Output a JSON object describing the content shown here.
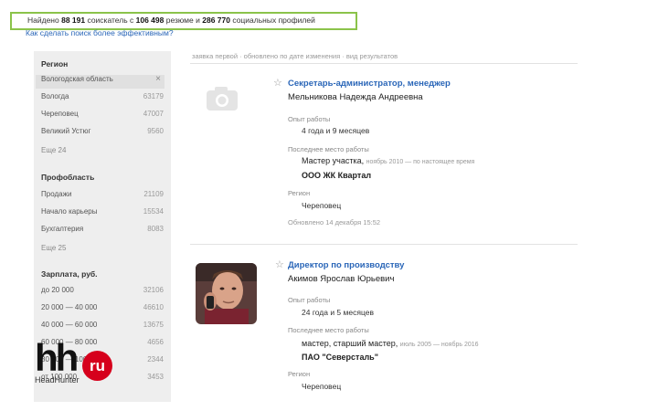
{
  "summary": {
    "prefix": "Найдено",
    "seekers_count": "88 191",
    "seekers_label": "соискатель с",
    "resumes_count": "106 498",
    "resumes_label": "резюме и",
    "profiles_count": "286 770",
    "profiles_label": "социальных профилей"
  },
  "tip_link": "Как сделать поиск более эффективным?",
  "sidebar": {
    "region": {
      "title": "Регион",
      "selected": {
        "label": "Вологодская область"
      },
      "items": [
        {
          "label": "Вологда",
          "count": "63179"
        },
        {
          "label": "Череповец",
          "count": "47007"
        },
        {
          "label": "Великий Устюг",
          "count": "9560"
        }
      ],
      "more": "Еще 24"
    },
    "profarea": {
      "title": "Профобласть",
      "items": [
        {
          "label": "Продажи",
          "count": "21109"
        },
        {
          "label": "Начало карьеры",
          "count": "15534"
        },
        {
          "label": "Бухгалтерия",
          "count": "8083"
        }
      ],
      "more": "Еще 25"
    },
    "salary": {
      "title": "Зарплата, руб.",
      "items": [
        {
          "label": "до 20 000",
          "count": "32106"
        },
        {
          "label": "20 000 — 40 000",
          "count": "46610"
        },
        {
          "label": "40 000 — 60 000",
          "count": "13675"
        },
        {
          "label": "60 000 — 80 000",
          "count": "4656"
        },
        {
          "label": "80 000 — 100 000",
          "count": "2344"
        },
        {
          "label": "от 100 000",
          "count": "3453"
        }
      ]
    }
  },
  "logo": {
    "main": "hh",
    "badge": "ru",
    "sub": "HeadHunter"
  },
  "breadcrumb": "заявка первой · обновлено по дате изменения · вид результатов",
  "results": [
    {
      "title": "Секретарь-администратор, менеджер",
      "name": "Мельникова Надежда Андреевна",
      "exp_label": "Опыт работы",
      "exp_value": "4 года и 9 месяцев",
      "last_label": "Последнее место работы",
      "position": "Мастер участка,",
      "dates": "ноябрь 2010 — по настоящее время",
      "company": "ООО ЖК Квартал",
      "region_label": "Регион",
      "region": "Череповец",
      "updated": "Обновлено 14 декабря 15:52",
      "has_photo": false
    },
    {
      "title": "Директор по производству",
      "name": "Акимов Ярослав Юрьевич",
      "exp_label": "Опыт работы",
      "exp_value": "24 года и 5 месяцев",
      "last_label": "Последнее место работы",
      "position": "мастер, старший мастер,",
      "dates": "июль 2005 — ноябрь 2016",
      "company": "ПАО \"Северсталь\"",
      "region_label": "Регион",
      "region": "Череповец",
      "has_photo": true
    }
  ],
  "colors": {
    "accent": "#2a66b8",
    "highlight": "#8bc34a",
    "brand": "#d6001c"
  }
}
